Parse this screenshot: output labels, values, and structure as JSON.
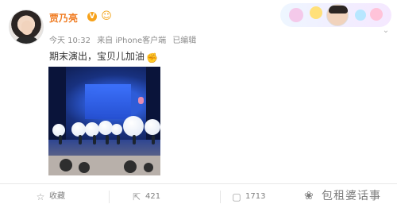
{
  "post": {
    "username": "贾乃亮",
    "verified_badge": "V",
    "meta": {
      "time": "今天 10:32",
      "source": "来自 iPhone客户端",
      "edited": "已编辑"
    },
    "text": "期末演出，宝贝儿加油",
    "text_emoji_icon": "flexed-biceps-icon"
  },
  "actions": {
    "favorite_label": "收藏",
    "repost_count": "421",
    "comment_count": "1713"
  },
  "watermark": "包租婆话事"
}
